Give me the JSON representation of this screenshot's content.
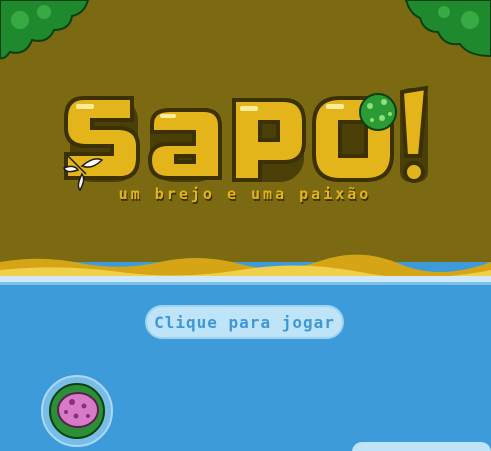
{
  "game": {
    "title": "SAPO!",
    "subtitle": "um brejo e uma paixão",
    "play_label": "Clique para jogar"
  },
  "colors": {
    "mud": "#7b6a12",
    "water": "#3d9bd9",
    "title_gold": "#e3b51b",
    "foliage": "#1f8a2d",
    "button_light": "#bfe4f8"
  },
  "icons": {
    "frog": "green-frog-icon",
    "fish": "pink-fish-icon",
    "dragonfly": "dragonfly-icon"
  }
}
